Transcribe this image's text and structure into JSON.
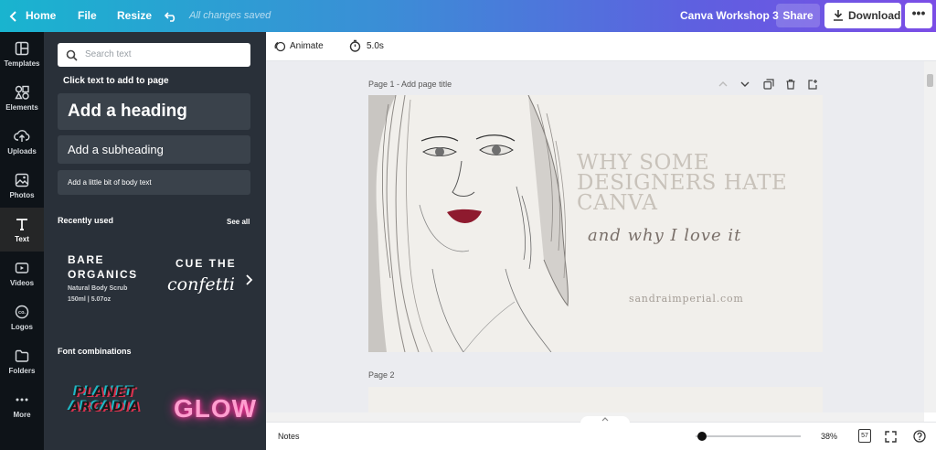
{
  "topbar": {
    "home": "Home",
    "file": "File",
    "resize": "Resize",
    "saved_status": "All changes saved",
    "doc_title": "Canva Workshop 3",
    "share": "Share",
    "download": "Download",
    "more": "•••"
  },
  "rail": {
    "items": [
      {
        "label": "Templates",
        "icon": "templates-icon"
      },
      {
        "label": "Elements",
        "icon": "elements-icon"
      },
      {
        "label": "Uploads",
        "icon": "upload-icon"
      },
      {
        "label": "Photos",
        "icon": "photo-icon"
      },
      {
        "label": "Text",
        "icon": "text-icon"
      },
      {
        "label": "Videos",
        "icon": "video-icon"
      },
      {
        "label": "Logos",
        "icon": "logo-icon"
      },
      {
        "label": "Folders",
        "icon": "folder-icon"
      },
      {
        "label": "More",
        "icon": "more-icon"
      }
    ]
  },
  "panel": {
    "search_placeholder": "Search text",
    "hint": "Click text to add to page",
    "heading": "Add a heading",
    "subheading": "Add a subheading",
    "body": "Add a little bit of body text",
    "recently_used": "Recently used",
    "see_all": "See all",
    "recent1": {
      "line1": "BARE",
      "line2": "ORGANICS",
      "line3": "Natural Body Scrub",
      "line4": "150ml | 5.07oz"
    },
    "recent2": {
      "line1": "CUE THE",
      "line2": "confetti"
    },
    "font_combinations": "Font combinations",
    "combo1": {
      "line1": "PLANET",
      "line2": "ARCADIA"
    },
    "combo2": "GLOW"
  },
  "toolbar": {
    "animate": "Animate",
    "duration": "5.0s"
  },
  "canvas": {
    "page1_label": "Page 1 - Add page title",
    "page2_label": "Page 2",
    "headline": [
      "WHY SOME",
      "DESIGNERS HATE",
      "CANVA"
    ],
    "script": "and why I love it",
    "website": "sandraimperial.com"
  },
  "footer": {
    "notes": "Notes",
    "zoom": "38%",
    "page_count": "57"
  },
  "colors": {
    "accent_start": "#19b4cf",
    "accent_end": "#7b4de6",
    "rail_bg": "#0e1318",
    "panel_bg": "#293039",
    "workspace_bg": "#ebecf0",
    "lip_color": "#8e1a2e"
  }
}
